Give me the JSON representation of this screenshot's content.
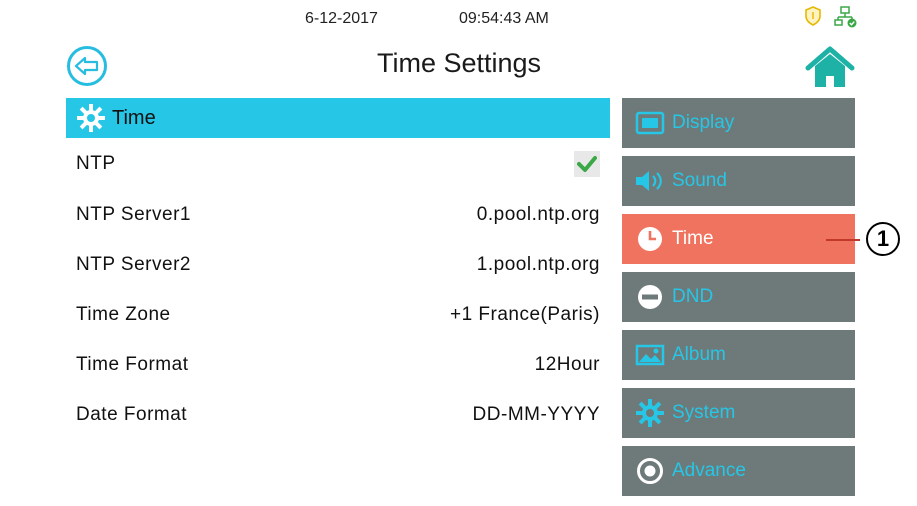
{
  "status_bar": {
    "date": "6-12-2017",
    "time": "09:54:43  AM"
  },
  "header": {
    "title": "Time Settings"
  },
  "section": {
    "label": "Time"
  },
  "rows": [
    {
      "label": "NTP",
      "value": "",
      "checked": true
    },
    {
      "label": "NTP Server1",
      "value": "0.pool.ntp.org"
    },
    {
      "label": "NTP Server2",
      "value": "1.pool.ntp.org"
    },
    {
      "label": "Time Zone",
      "value": "+1 France(Paris)"
    },
    {
      "label": "Time Format",
      "value": "12Hour"
    },
    {
      "label": "Date Format",
      "value": "DD-MM-YYYY"
    }
  ],
  "menu": [
    {
      "label": "Display",
      "icon": "display-icon"
    },
    {
      "label": "Sound",
      "icon": "speaker-icon"
    },
    {
      "label": "Time",
      "icon": "clock-icon",
      "active": true
    },
    {
      "label": "DND",
      "icon": "dnd-icon"
    },
    {
      "label": "Album",
      "icon": "album-icon"
    },
    {
      "label": "System",
      "icon": "gear-icon"
    },
    {
      "label": "Advance",
      "icon": "advance-icon"
    }
  ],
  "callout": {
    "number": "1"
  },
  "colors": {
    "accent": "#26c6e6",
    "menu_bg": "#6e7a79",
    "active": "#f0735f",
    "check": "#3aa845"
  }
}
